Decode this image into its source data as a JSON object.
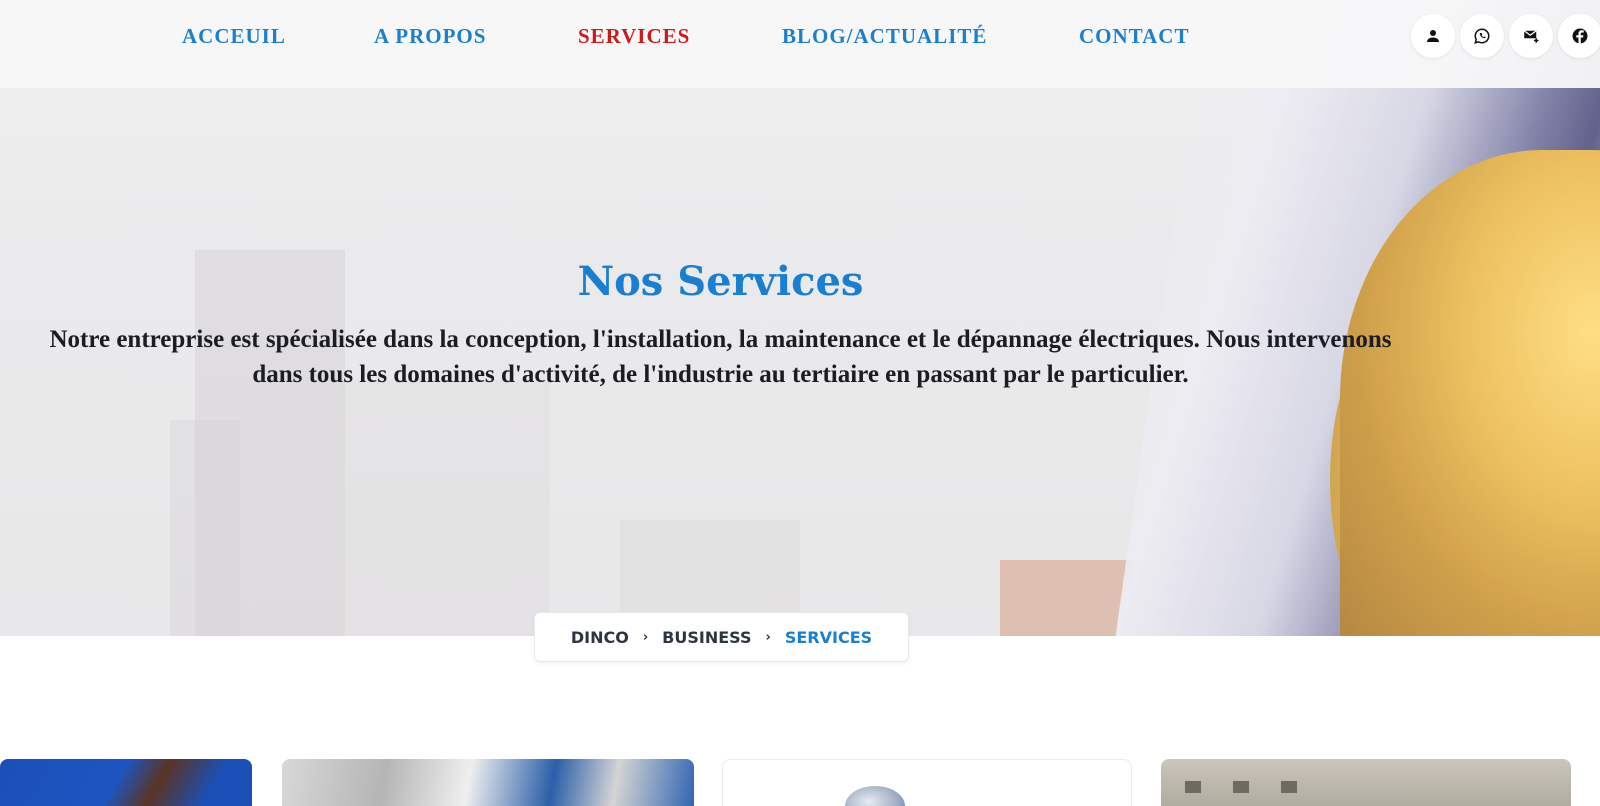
{
  "nav": {
    "items": [
      {
        "label": "ACCEUIL",
        "active": false
      },
      {
        "label": "A PROPOS",
        "active": false
      },
      {
        "label": "SERVICES",
        "active": true
      },
      {
        "label": "BLOG/ACTUALITÉ",
        "active": false
      },
      {
        "label": "CONTACT",
        "active": false
      }
    ],
    "social_icons": [
      "user-icon",
      "whatsapp-icon",
      "mail-plus-icon",
      "facebook-icon"
    ]
  },
  "hero": {
    "title": "Nos Services",
    "description": "Notre entreprise est spécialisée dans la conception, l'installation, la maintenance et le dépannage électriques. Nous intervenons dans tous les domaines d'activité, de l'industrie au tertiaire en passant par le particulier."
  },
  "breadcrumb": {
    "items": [
      "DINCO",
      "BUSINESS"
    ],
    "current": "SERVICES",
    "separator": "›"
  },
  "colors": {
    "accent": "#1a7fd0",
    "active": "#cc1a1a",
    "text_dark": "#1c1c24"
  },
  "cards": [
    {
      "image": "worker-blue-uniform"
    },
    {
      "image": "electrical-cables"
    },
    {
      "image": "computer-mouse"
    },
    {
      "image": "building-exterior"
    }
  ]
}
